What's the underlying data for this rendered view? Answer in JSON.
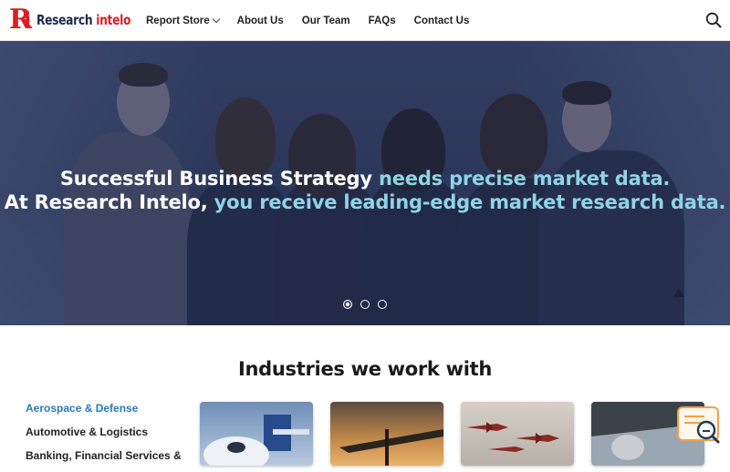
{
  "brand": {
    "logo_text_main": "Research ",
    "logo_text_accent": "intelo"
  },
  "nav": {
    "items": [
      {
        "label": "Report Store",
        "has_dropdown": true
      },
      {
        "label": "About Us"
      },
      {
        "label": "Our Team"
      },
      {
        "label": "FAQs"
      },
      {
        "label": "Contact Us"
      }
    ],
    "search_icon": "search-icon"
  },
  "hero": {
    "line1_white": "Successful Business Strategy ",
    "line1_highlight": "needs precise market data.",
    "line2_white": "At Research Intelo, ",
    "line2_highlight": "you receive leading-edge market research data.",
    "slides_total": 3,
    "active_slide": 1
  },
  "industries": {
    "title": "Industries we work with",
    "items": [
      {
        "label": "Aerospace & Defense",
        "active": true
      },
      {
        "label": "Automotive & Logistics",
        "active": false
      },
      {
        "label": "Banking, Financial Services &",
        "active": false
      }
    ],
    "cards": [
      {
        "icon": "airplane-image"
      },
      {
        "icon": "wind-turbine-image"
      },
      {
        "icon": "fighter-jets-image"
      },
      {
        "icon": "aircraft-wing-image"
      }
    ]
  },
  "colors": {
    "brand_red": "#d71f26",
    "navy": "#1d2b4f",
    "hero_highlight": "#8fd3e6",
    "industry_active": "#2a7ab8",
    "chat_orange": "#f0a04b"
  },
  "chat_widget": {
    "icon": "chat-search-icon"
  }
}
